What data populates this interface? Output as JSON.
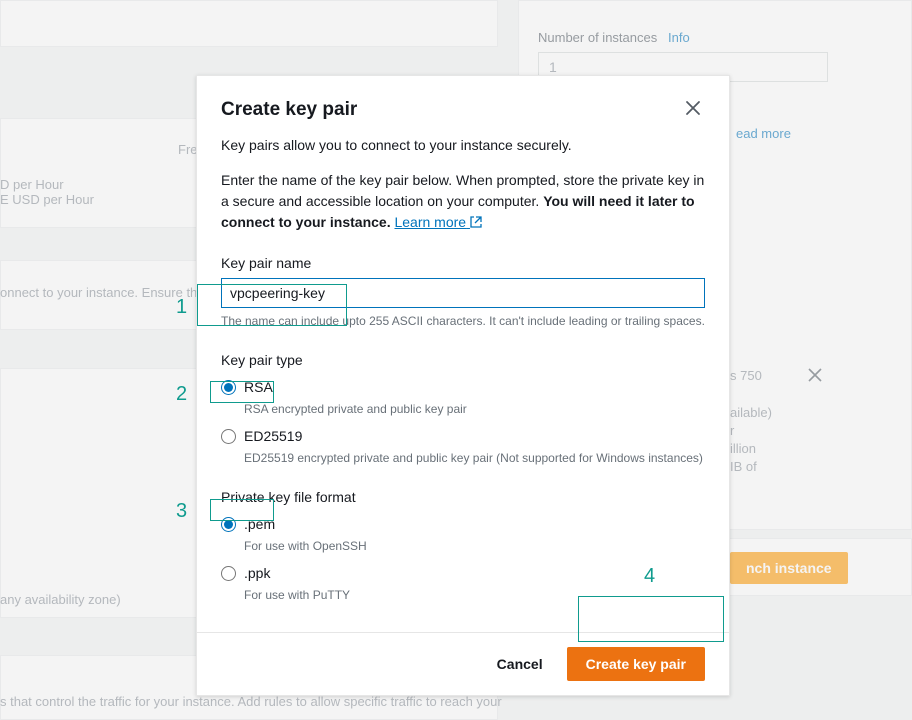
{
  "background": {
    "free_tier_label": "Free",
    "price_line1": "D per Hour",
    "price_line2": "E USD per Hour",
    "connect_text": "onnect to your instance. Ensure that yo",
    "az_text": "any availability zone)",
    "sg_text": "s that control the traffic for your instance. Add rules to allow specific traffic to reach your",
    "number_instances_label": "Number of instances",
    "info_link": "Info",
    "number_instances_value": "1",
    "read_more": "ead more",
    "hint1": "s 750",
    "hint2": "ailable)",
    "hint3": "r",
    "hint4": "illion",
    "hint5": "IB of",
    "launch_button": "nch instance"
  },
  "modal": {
    "title": "Create key pair",
    "intro": "Key pairs allow you to connect to your instance securely.",
    "para2_a": "Enter the name of the key pair below. When prompted, store the private key in a secure and accessible location on your computer. ",
    "para2_b": "You will need it later to connect to your instance.",
    "learn_more": "Learn more",
    "name_label": "Key pair name",
    "name_value": "vpcpeering-key",
    "name_helper": "The name can include upto 255 ASCII characters. It can't include leading or trailing spaces.",
    "type_label": "Key pair type",
    "type_rsa_label": "RSA",
    "type_rsa_desc": "RSA encrypted private and public key pair",
    "type_ed_label": "ED25519",
    "type_ed_desc": "ED25519 encrypted private and public key pair (Not supported for Windows instances)",
    "format_label": "Private key file format",
    "format_pem_label": ".pem",
    "format_pem_desc": "For use with OpenSSH",
    "format_ppk_label": ".ppk",
    "format_ppk_desc": "For use with PuTTY",
    "cancel": "Cancel",
    "create": "Create key pair"
  },
  "annotations": {
    "n1": "1",
    "n2": "2",
    "n3": "3",
    "n4": "4"
  }
}
